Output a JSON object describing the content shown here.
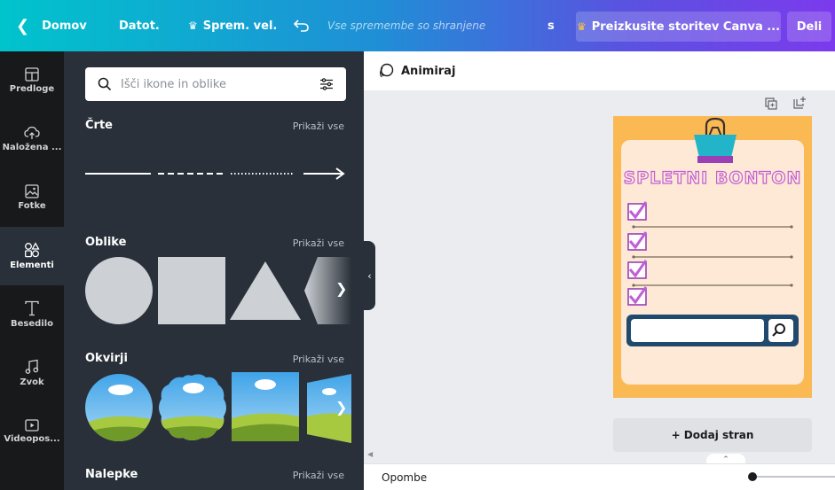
{
  "topbar": {
    "back_label": "Domov",
    "file_label": "Datot.",
    "resize_label": "Sprem. vel.",
    "status_text": "Vse spremembe so shranjene",
    "user_initial": "s",
    "trial_label": "Preizkusite storitev Canva ...",
    "share_label": "Deli"
  },
  "rail": {
    "items": [
      {
        "label": "Predloge",
        "icon": "templates-icon"
      },
      {
        "label": "Naložena ...",
        "icon": "upload-icon"
      },
      {
        "label": "Fotke",
        "icon": "photos-icon"
      },
      {
        "label": "Elementi",
        "icon": "elements-icon"
      },
      {
        "label": "Besedilo",
        "icon": "text-icon"
      },
      {
        "label": "Zvok",
        "icon": "audio-icon"
      },
      {
        "label": "Videopos...",
        "icon": "video-icon"
      }
    ]
  },
  "panel": {
    "search_placeholder": "Išči ikone in oblike",
    "sections": [
      {
        "title": "Črte",
        "more": "Prikaži vse"
      },
      {
        "title": "Oblike",
        "more": "Prikaži vse"
      },
      {
        "title": "Okvirji",
        "more": "Prikaži vse"
      },
      {
        "title": "Nalepke",
        "more": "Prikaži vse"
      }
    ]
  },
  "editor": {
    "animate_label": "Animiraj",
    "design_title": "SPLETNI BONTON",
    "add_page_label": "+ Dodaj stran",
    "notes_label": "Opombe"
  },
  "colors": {
    "accent": "#7c3aed",
    "page_bg": "#fbb954",
    "paper_bg": "#fde9d6",
    "check_purple": "#c15ed6",
    "search_navy": "#1f4a6e"
  }
}
